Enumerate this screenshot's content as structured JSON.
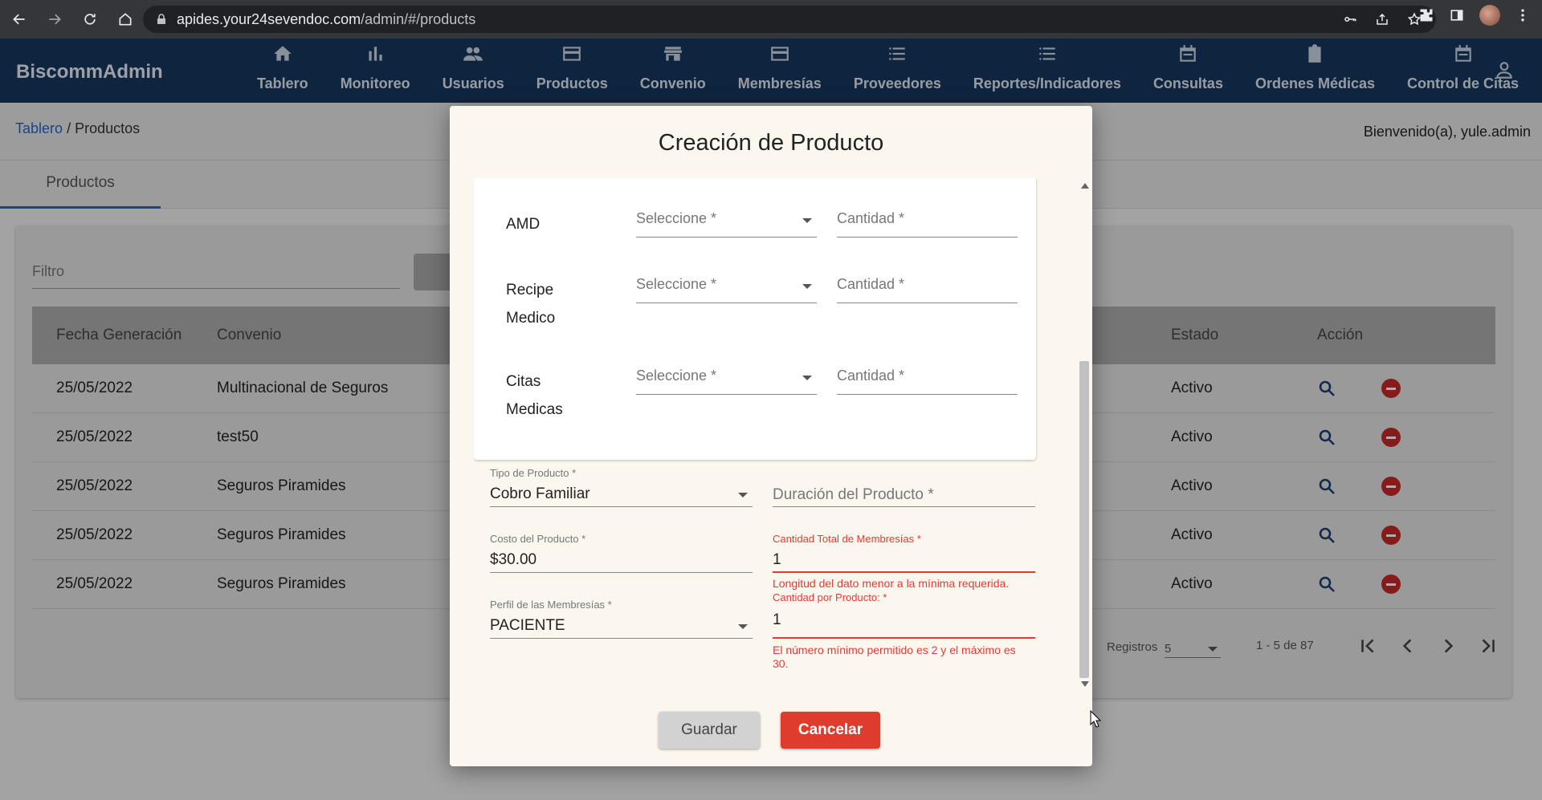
{
  "browser": {
    "url_host": "apides.your24sevendoc.com",
    "url_path": "/admin/#/products"
  },
  "app": {
    "brand": "BiscommAdmin",
    "nav": [
      {
        "label": "Tablero",
        "icon": "home-icon"
      },
      {
        "label": "Monitoreo",
        "icon": "bar-chart-icon"
      },
      {
        "label": "Usuarios",
        "icon": "people-icon"
      },
      {
        "label": "Productos",
        "icon": "card-icon"
      },
      {
        "label": "Convenio",
        "icon": "store-icon"
      },
      {
        "label": "Membresías",
        "icon": "card-icon"
      },
      {
        "label": "Proveedores",
        "icon": "list-icon"
      },
      {
        "label": "Reportes/Indicadores",
        "icon": "list-icon"
      },
      {
        "label": "Consultas",
        "icon": "calendar-icon"
      },
      {
        "label": "Ordenes Médicas",
        "icon": "clipboard-icon"
      },
      {
        "label": "Control de Citas",
        "icon": "calendar-icon"
      }
    ]
  },
  "breadcrumb": {
    "root": "Tablero",
    "separator": "/",
    "current": "Productos"
  },
  "welcome": "Bienvenido(a), yule.admin",
  "tab": "Productos",
  "filter": {
    "placeholder": "Filtro"
  },
  "table": {
    "headers": {
      "fecha": "Fecha Generación",
      "convenio": "Convenio",
      "estado": "Estado",
      "accion": "Acción"
    },
    "rows": [
      {
        "fecha": "25/05/2022",
        "convenio": "Multinacional de Seguros",
        "estado": "Activo"
      },
      {
        "fecha": "25/05/2022",
        "convenio": "test50",
        "estado": "Activo"
      },
      {
        "fecha": "25/05/2022",
        "convenio": "Seguros Piramides",
        "estado": "Activo"
      },
      {
        "fecha": "25/05/2022",
        "convenio": "Seguros Piramides",
        "estado": "Activo"
      },
      {
        "fecha": "25/05/2022",
        "convenio": "Seguros Piramides",
        "estado": "Activo"
      }
    ]
  },
  "pager": {
    "registros_label": "Registros",
    "page_size": "5",
    "range": "1 - 5 de 87"
  },
  "modal": {
    "title": "Creación de Producto",
    "services": [
      {
        "label_lines": [
          "AMD"
        ],
        "select_placeholder": "Seleccione *",
        "qty_placeholder": "Cantidad *"
      },
      {
        "label_lines": [
          "Recipe",
          "Medico"
        ],
        "select_placeholder": "Seleccione *",
        "qty_placeholder": "Cantidad *"
      },
      {
        "label_lines": [
          "Citas",
          "Medicas"
        ],
        "select_placeholder": "Seleccione *",
        "qty_placeholder": "Cantidad *"
      }
    ],
    "tipo_producto": {
      "label": "Tipo de Producto *",
      "value": "Cobro Familiar"
    },
    "duracion": {
      "placeholder": "Duración del Producto *"
    },
    "costo": {
      "label": "Costo del Producto *",
      "value": "$30.00"
    },
    "cantidad_total": {
      "label": "Cantidad Total de Membresías *",
      "value": "1",
      "error": "Longitud del dato menor a la mínima requerida."
    },
    "perfil": {
      "label": "Perfil de las Membresías *",
      "value": "PACIENTE"
    },
    "cantidad_producto": {
      "label": "Cantidad por Producto: *",
      "value": "1",
      "error_line1": "El número mínimo permitido es 2 y el máximo es",
      "error_line2": "30."
    },
    "save_label": "Guardar",
    "cancel_label": "Cancelar"
  },
  "colors": {
    "header_bg": "#17375e",
    "error": "#e53935",
    "cancel": "#e03c2e",
    "link": "#2a64c7"
  }
}
